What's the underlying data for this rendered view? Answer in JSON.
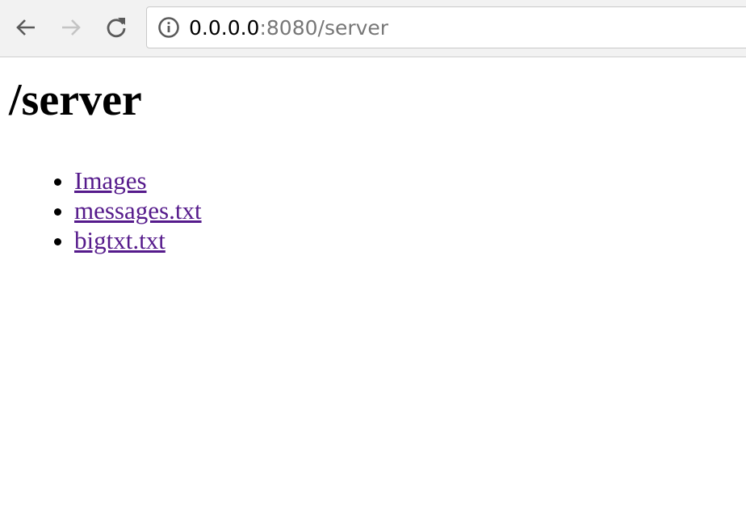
{
  "browser": {
    "url_host": "0.0.0.0",
    "url_rest": ":8080/server",
    "icons": {
      "back": "arrow-left-icon",
      "forward": "arrow-right-icon",
      "reload": "reload-icon",
      "info": "info-icon"
    }
  },
  "page": {
    "heading": "/server",
    "links": [
      {
        "label": "Images"
      },
      {
        "label": "messages.txt"
      },
      {
        "label": "bigtxt.txt"
      }
    ]
  },
  "colors": {
    "visited_link": "#551a8b",
    "toolbar_bg": "#f2f2f2",
    "url_path": "#777777"
  }
}
